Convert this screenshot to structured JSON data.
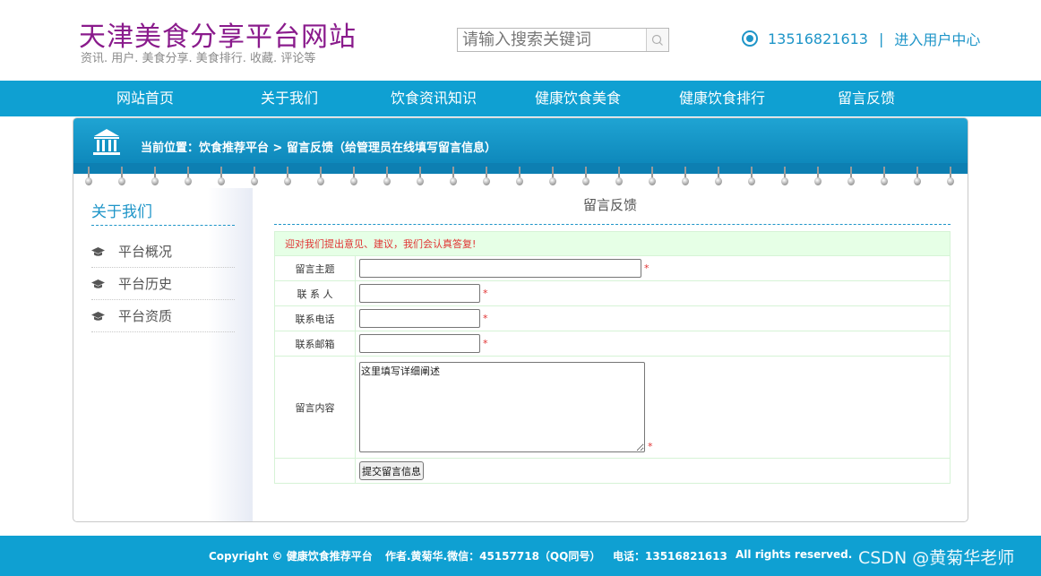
{
  "header": {
    "site_title": "天津美食分享平台网站",
    "site_subtitle": "资讯. 用户. 美食分享. 美食排行. 收藏. 评论等",
    "search_placeholder": "请输入搜索关键词",
    "phone": "13516821613",
    "separator": "|",
    "user_center_link": "进入用户中心",
    "accent_color": "#1e95c8",
    "title_color": "#8a1b8c"
  },
  "nav": {
    "items": [
      "网站首页",
      "关于我们",
      "饮食资讯知识",
      "健康饮食美食",
      "健康饮食排行",
      "留言反馈"
    ],
    "bg_color": "#0fa0d2"
  },
  "breadcrumb": {
    "text": "当前位置：饮食推荐平台 > 留言反馈（给管理员在线填写留言信息）"
  },
  "sidebar": {
    "title": "关于我们",
    "items": [
      "平台概况",
      "平台历史",
      "平台资质"
    ],
    "item_icon": "graduation-cap-icon"
  },
  "content": {
    "title": "留言反馈",
    "notice": "迎对我们提出意见、建议，我们会认真答复!",
    "required_mark": "*",
    "fields": {
      "subject_label": "留言主题",
      "contact_label": "联 系 人",
      "phone_label": "联系电话",
      "email_label": "联系邮箱",
      "message_label": "留言内容",
      "message_placeholder": "这里填写详细阐述",
      "subject_value": "",
      "contact_value": "",
      "phone_value": "",
      "email_value": ""
    },
    "submit_label": "提交留言信息"
  },
  "footer": {
    "copyright": "Copyright © 健康饮食推荐平台",
    "author": "作者.黄菊华.微信：45157718（QQ同号）",
    "phone": "电话：13516821613",
    "rights": "All rights reserved."
  },
  "watermark": "CSDN @黄菊华老师"
}
